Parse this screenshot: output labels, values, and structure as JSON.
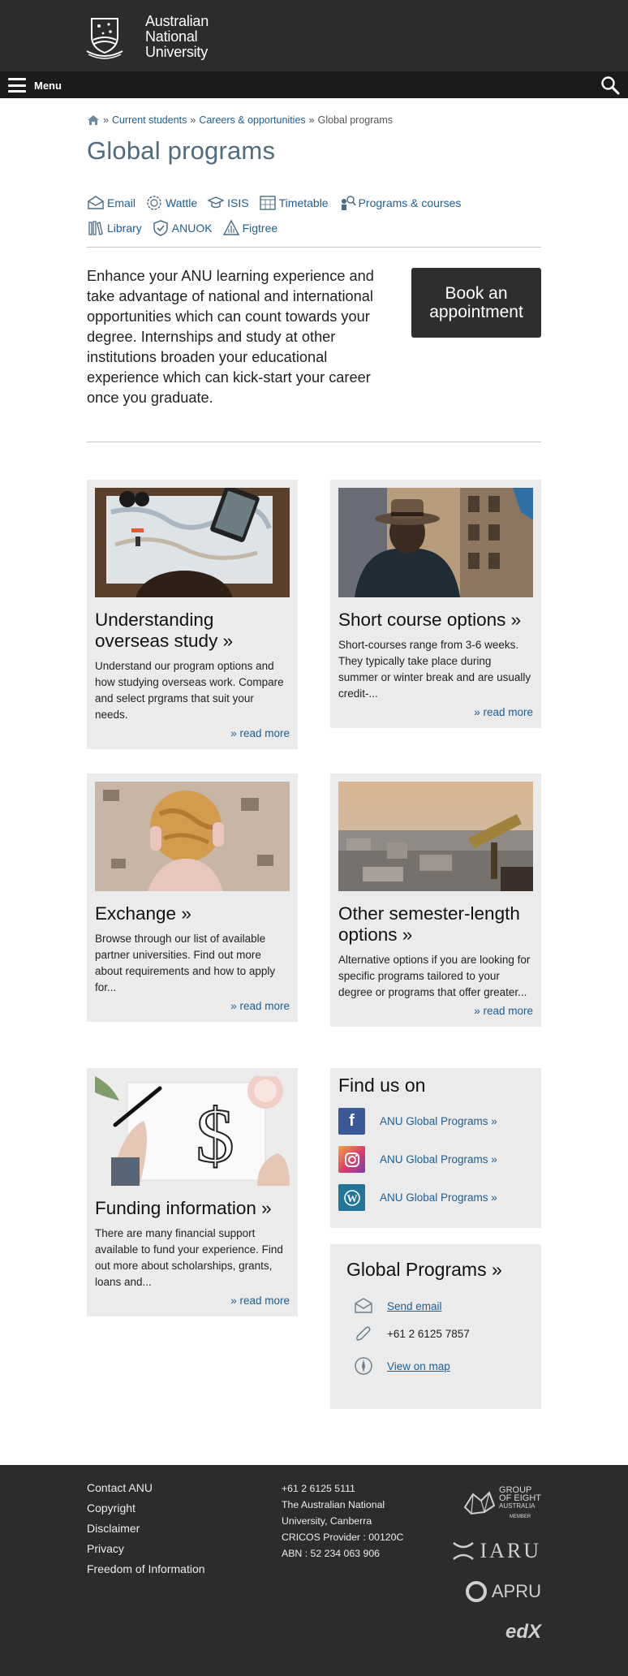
{
  "header": {
    "logo_lines": [
      "Australian",
      "National",
      "University"
    ],
    "menu_label": "Menu"
  },
  "breadcrumb": {
    "separator": "»",
    "items": [
      "Current students",
      "Careers & opportunities"
    ],
    "current": "Global programs"
  },
  "page_title": "Global programs",
  "quicklinks": {
    "row1": [
      {
        "label": "Email",
        "icon": "email-icon"
      },
      {
        "label": "Wattle",
        "icon": "wattle-icon"
      },
      {
        "label": "ISIS",
        "icon": "isis-icon"
      },
      {
        "label": "Timetable",
        "icon": "timetable-icon"
      },
      {
        "label": "Programs & courses",
        "icon": "programs-icon"
      }
    ],
    "row2": [
      {
        "label": "Library",
        "icon": "library-icon"
      },
      {
        "label": "ANUOK",
        "icon": "anuok-icon"
      },
      {
        "label": "Figtree",
        "icon": "figtree-icon"
      }
    ]
  },
  "intro": {
    "text": "Enhance your ANU learning experience and take advantage of national and international opportunities which can count towards your degree. Internships and study at other institutions broaden your educational experience which can kick-start your career once you graduate.",
    "button": "Book an appointment"
  },
  "cards": [
    {
      "title": "Understanding overseas study »",
      "text": "Understand our program options and how studying overseas work. Compare and select prgrams that suit your needs.",
      "more": "» read more",
      "image": "map-planning-photo"
    },
    {
      "title": "Short course options »",
      "text": "Short-courses range from 3-6 weeks. They typically take place during summer or winter break and are usually credit-...",
      "more": "» read more",
      "image": "traveller-hat-photo"
    },
    {
      "title": "Exchange »",
      "text": "Browse through our list of available partner universities. Find out more about requirements and how to apply for...",
      "more": "» read more",
      "image": "globe-photo"
    },
    {
      "title": "Other semester-length options »",
      "text": "Alternative options if you are looking for specific programs tailored to your degree or programs that offer greater...",
      "more": "» read more",
      "image": "telescope-city-photo"
    },
    {
      "title": "Funding information »",
      "text": "There are many financial support available to fund your experience. Find out more about scholarships, grants, loans and...",
      "more": "» read more",
      "image": "dollar-sketch-photo"
    }
  ],
  "find_us": {
    "title": "Find us on",
    "items": [
      {
        "label": "ANU Global Programs »",
        "icon": "facebook-icon",
        "color": "#3b5998"
      },
      {
        "label": "ANU Global Programs »",
        "icon": "instagram-icon",
        "color": "#d93b6e"
      },
      {
        "label": "ANU Global Programs »",
        "icon": "wordpress-icon",
        "color": "#21759b"
      }
    ]
  },
  "contact": {
    "title": "Global Programs »",
    "email": "Send email",
    "phone": "+61 2 6125 7857",
    "map": "View on map"
  },
  "footer": {
    "links": [
      "Contact ANU",
      "Copyright",
      "Disclaimer",
      "Privacy",
      "Freedom of Information"
    ],
    "info": [
      "+61 2 6125 5111",
      "The Australian National",
      "University, Canberra",
      "CRICOS Provider : 00120C",
      "ABN : 52 234 063 906"
    ],
    "logos": {
      "go8": [
        "GROUP",
        "OF EIGHT",
        "AUSTRALIA",
        "MEMBER"
      ],
      "iaru": "IARU",
      "apru": "APRU",
      "edx": "edX"
    }
  },
  "colors": {
    "title": "#4f6b7e",
    "link": "#1d5e94",
    "header": "#2c2c2c",
    "card_bg": "#ebebeb"
  }
}
